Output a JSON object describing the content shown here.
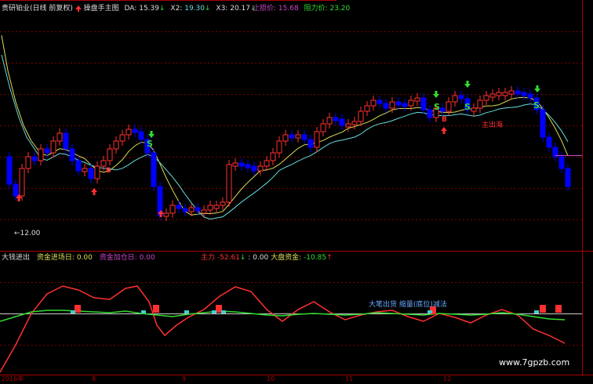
{
  "upper_panel": {
    "stock_name": "贵研铂业(日线 前复权)",
    "indicator_name": "操盘手主图",
    "da_label": "DA:",
    "da_value": "15.39",
    "x2_label": "X2:",
    "x2_value": "19.30",
    "x3_label": "X3:",
    "x3_value": "20.17",
    "stop_loss_label": "止损价:",
    "stop_loss_value": "15.68",
    "resistance_label": "阻力价:",
    "resistance_value": "23.20",
    "price_marker": "12.00",
    "signal_s": "S",
    "signal_b": "B",
    "signal_exit": "主出海",
    "colors": {
      "up": "#ff3232",
      "down": "#0000ff",
      "ma_yellow": "#dddd55",
      "ma_cyan": "#66dddd"
    }
  },
  "lower_panel": {
    "name": "大钱进出",
    "inflow_day_label": "资金进场日:",
    "inflow_day_value": "0.00",
    "add_day_label": "资金加仓日:",
    "add_day_value": "0.00",
    "main_label": "主力",
    "main_value": "-52.61",
    "sep_value": ": 0.00",
    "market_label": "大盘资金:",
    "market_value": "-10.85",
    "annotation": "大笔出货 缩量(底位)减法",
    "colors": {
      "main": "#ff3030",
      "market": "#30dd30",
      "bar_red": "#ff3030",
      "bar_cyan": "#44cccc"
    }
  },
  "axis": {
    "dates": [
      "2016年",
      "8",
      "9",
      "10",
      "11",
      "12"
    ]
  },
  "watermark": "www.7gpzb.com"
}
